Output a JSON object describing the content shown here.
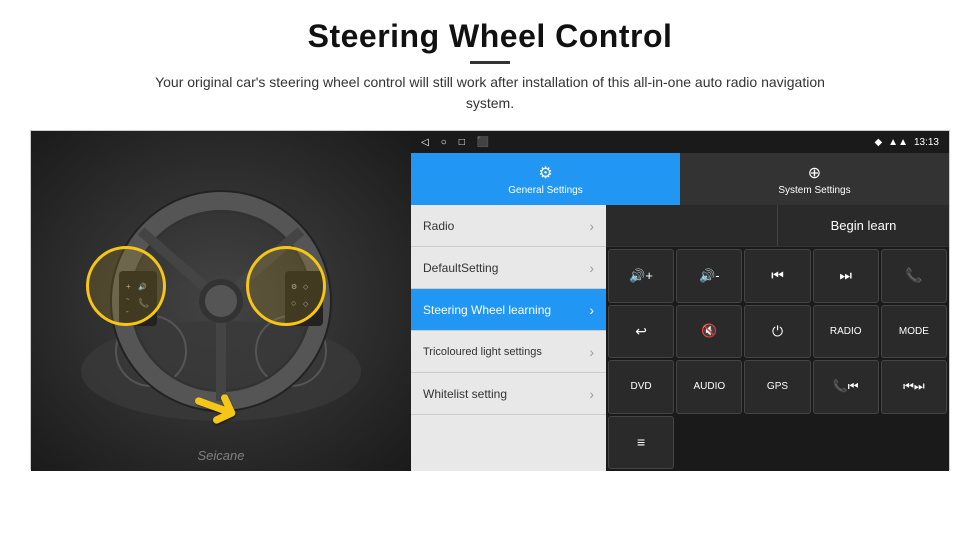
{
  "header": {
    "title": "Steering Wheel Control",
    "subtitle": "Your original car's steering wheel control will still work after installation of this all-in-one auto radio navigation system."
  },
  "status_bar": {
    "left_icons": [
      "◁",
      "○",
      "□",
      "⬛"
    ],
    "right_time": "13:13",
    "right_icons": [
      "◆",
      "▲"
    ]
  },
  "tabs": [
    {
      "label": "General Settings",
      "icon": "⚙",
      "active": true
    },
    {
      "label": "System Settings",
      "icon": "⚙",
      "active": false
    }
  ],
  "menu": {
    "items": [
      {
        "label": "Radio",
        "active": false
      },
      {
        "label": "DefaultSetting",
        "active": false
      },
      {
        "label": "Steering Wheel learning",
        "active": true
      },
      {
        "label": "Tricoloured light settings",
        "active": false
      },
      {
        "label": "Whitelist setting",
        "active": false
      }
    ]
  },
  "controls": {
    "begin_learn_label": "Begin learn",
    "buttons": [
      {
        "label": "🔊+",
        "type": "icon"
      },
      {
        "label": "🔊-",
        "type": "icon"
      },
      {
        "label": "⏮",
        "type": "icon"
      },
      {
        "label": "⏭",
        "type": "icon"
      },
      {
        "label": "📞",
        "type": "icon"
      },
      {
        "label": "↩",
        "type": "icon"
      },
      {
        "label": "🔇",
        "type": "icon"
      },
      {
        "label": "⏻",
        "type": "icon"
      },
      {
        "label": "RADIO",
        "type": "text"
      },
      {
        "label": "MODE",
        "type": "text"
      },
      {
        "label": "DVD",
        "type": "text"
      },
      {
        "label": "AUDIO",
        "type": "text"
      },
      {
        "label": "GPS",
        "type": "text"
      },
      {
        "label": "📞⏮",
        "type": "icon"
      },
      {
        "label": "⏮⏭",
        "type": "icon"
      },
      {
        "label": "≡",
        "type": "icon"
      }
    ]
  },
  "watermark": "Seicane"
}
